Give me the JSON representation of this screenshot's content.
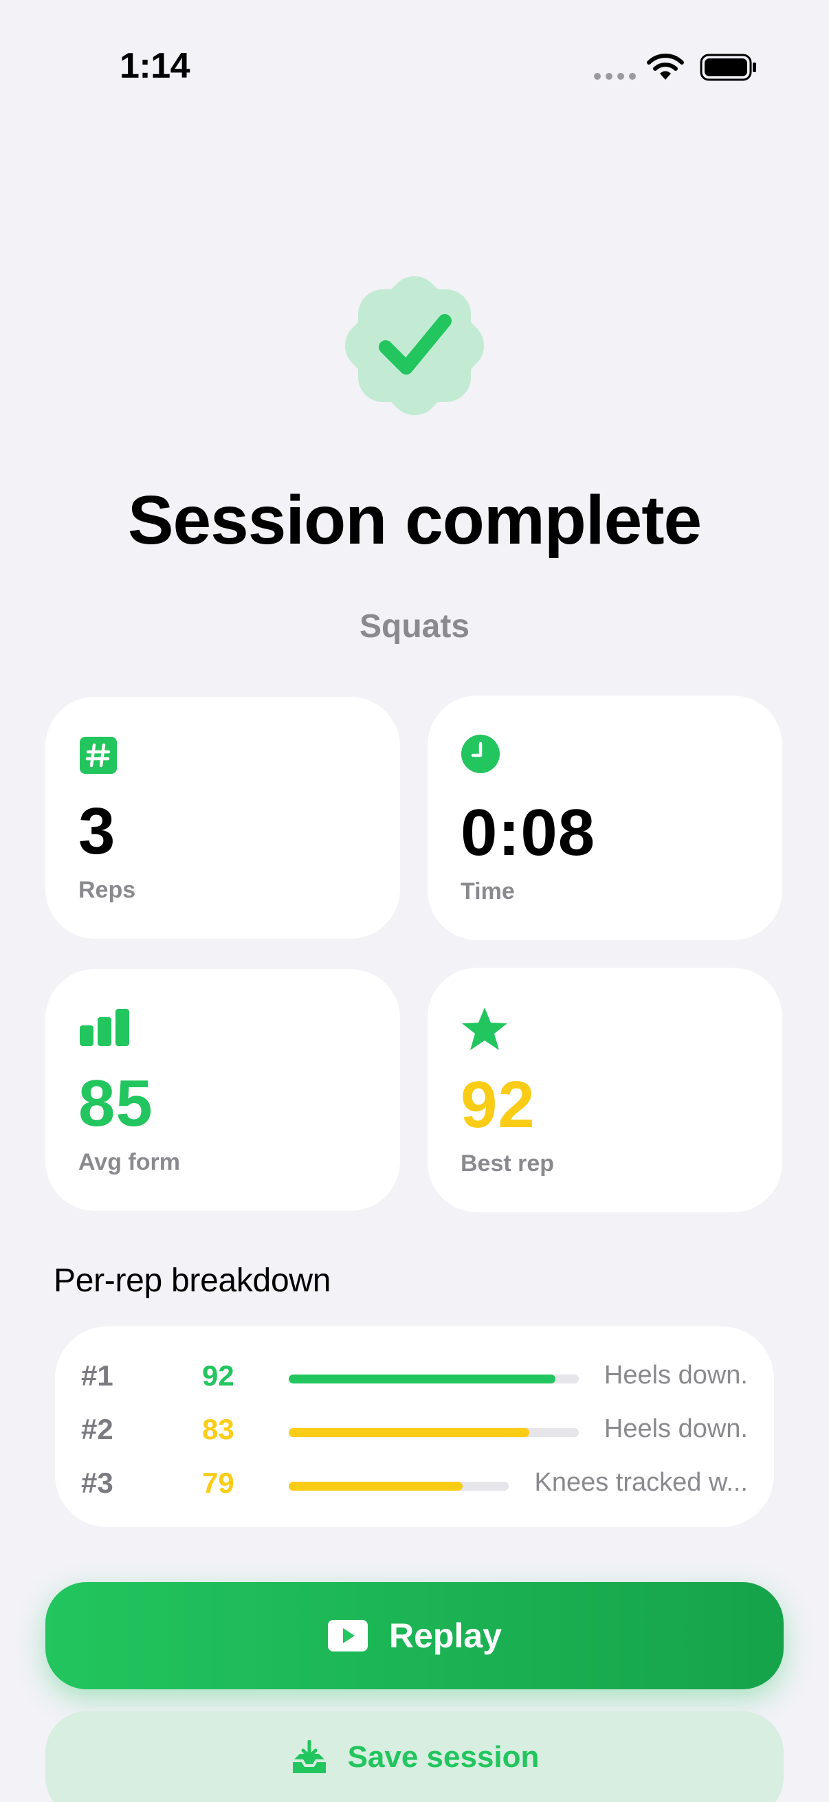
{
  "status_bar": {
    "time": "1:14"
  },
  "header": {
    "title": "Session complete",
    "exercise": "Squats"
  },
  "stats": {
    "reps": {
      "value": "3",
      "label": "Reps",
      "icon": "hash-icon"
    },
    "time": {
      "value": "0:08",
      "label": "Time",
      "icon": "clock-icon"
    },
    "avg_form": {
      "value": "85",
      "label": "Avg form",
      "icon": "bar-chart-icon"
    },
    "best_rep": {
      "value": "92",
      "label": "Best rep",
      "icon": "star-icon"
    }
  },
  "breakdown": {
    "title": "Per-rep breakdown",
    "reps": [
      {
        "num": "#1",
        "score": "92",
        "score_value": 92,
        "note": "Heels down.",
        "color": "#22c55e"
      },
      {
        "num": "#2",
        "score": "83",
        "score_value": 83,
        "note": "Heels down.",
        "color": "#facc15"
      },
      {
        "num": "#3",
        "score": "79",
        "score_value": 79,
        "note": "Knees tracked w...",
        "color": "#facc15"
      }
    ]
  },
  "actions": {
    "replay_label": "Replay",
    "save_label": "Save session"
  },
  "colors": {
    "accent": "#22c55e",
    "highlight": "#facc15",
    "muted": "#8a8a8e",
    "background": "#f2f2f7"
  }
}
